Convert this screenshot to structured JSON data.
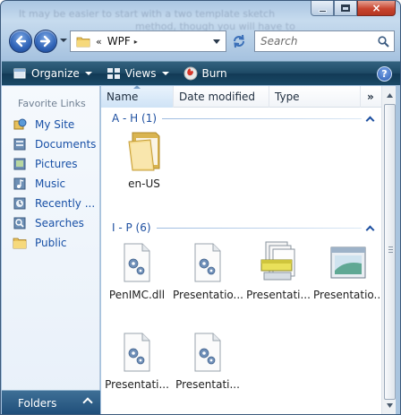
{
  "window": {
    "ghost_text_1": "It may be easier to start with a two template sketch",
    "ghost_text_2": "method, though you will have to"
  },
  "caption": {
    "minimize": "minimize-icon",
    "maximize": "maximize-icon",
    "close": "×"
  },
  "address": {
    "chevrons": "«",
    "folder": "WPF",
    "separator": "▸"
  },
  "search": {
    "placeholder": "Search"
  },
  "toolbar": {
    "organize": "Organize",
    "views": "Views",
    "burn": "Burn",
    "help": "?"
  },
  "navpane": {
    "heading": "Favorite Links",
    "items": [
      {
        "label": "My Site",
        "icon": "my-site-icon"
      },
      {
        "label": "Documents",
        "icon": "documents-icon"
      },
      {
        "label": "Pictures",
        "icon": "pictures-icon"
      },
      {
        "label": "Music",
        "icon": "music-icon"
      },
      {
        "label": "Recently ...",
        "icon": "recent-icon"
      },
      {
        "label": "Searches",
        "icon": "searches-icon"
      },
      {
        "label": "Public",
        "icon": "public-folder-icon"
      }
    ],
    "folders_label": "Folders"
  },
  "columns": {
    "name": "Name",
    "date": "Date modified",
    "type": "Type",
    "more": "»"
  },
  "groups": [
    {
      "title": "A - H (1)",
      "files": [
        {
          "name": "en-US",
          "icon": "folder-icon"
        }
      ]
    },
    {
      "title": "I - P (6)",
      "files": [
        {
          "name": "PenIMC.dll",
          "icon": "dll-file-icon"
        },
        {
          "name": "Presentatio...",
          "icon": "dll-file-icon"
        },
        {
          "name": "Presentati...",
          "icon": "stacked-documents-icon"
        },
        {
          "name": "Presentatio...",
          "icon": "window-app-icon"
        },
        {
          "name": "Presentati...",
          "icon": "dll-file-icon"
        },
        {
          "name": "Presentati...",
          "icon": "dll-file-icon"
        }
      ]
    }
  ],
  "colors": {
    "link_blue": "#1850a6",
    "group_blue": "#1d4fa0",
    "toolbar_dark": "#1e4a66",
    "folder_yellow": "#f2d47a"
  }
}
